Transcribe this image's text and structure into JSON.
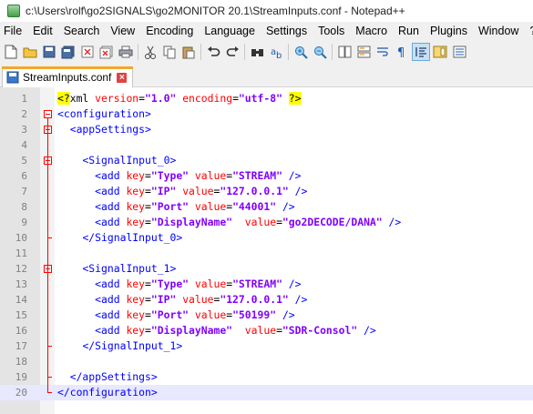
{
  "window": {
    "title": "c:\\Users\\rolf\\go2SIGNALS\\go2MONITOR 20.1\\StreamInputs.conf - Notepad++"
  },
  "menu": {
    "items": [
      "File",
      "Edit",
      "Search",
      "View",
      "Encoding",
      "Language",
      "Settings",
      "Tools",
      "Macro",
      "Run",
      "Plugins",
      "Window",
      "?"
    ]
  },
  "toolbar": {
    "buttons": [
      "new-file",
      "open-file",
      "save",
      "save-all",
      "close",
      "close-all",
      "print",
      "cut",
      "copy",
      "paste",
      "undo",
      "redo",
      "find",
      "replace",
      "zoom-in",
      "zoom-out",
      "sync-vertical",
      "sync-horizontal",
      "word-wrap",
      "show-all-characters",
      "indent-guide",
      "document-map",
      "function-list"
    ]
  },
  "tabs": [
    {
      "label": "StreamInputs.conf",
      "active": true
    }
  ],
  "editor": {
    "current_line": 20,
    "lines": [
      {
        "n": "1",
        "text": "<?xml version=\"1.0\" encoding=\"utf-8\" ?>"
      },
      {
        "n": "2",
        "text": "<configuration>"
      },
      {
        "n": "3",
        "text": "  <appSettings>"
      },
      {
        "n": "4",
        "text": ""
      },
      {
        "n": "5",
        "text": "    <SignalInput_0>"
      },
      {
        "n": "6",
        "text": "      <add key=\"Type\" value=\"STREAM\" />"
      },
      {
        "n": "7",
        "text": "      <add key=\"IP\" value=\"127.0.0.1\" />"
      },
      {
        "n": "8",
        "text": "      <add key=\"Port\" value=\"44001\" />"
      },
      {
        "n": "9",
        "text": "      <add key=\"DisplayName\"  value=\"go2DECODE/DANA\" />"
      },
      {
        "n": "10",
        "text": "    </SignalInput_0>"
      },
      {
        "n": "11",
        "text": ""
      },
      {
        "n": "12",
        "text": "    <SignalInput_1>"
      },
      {
        "n": "13",
        "text": "      <add key=\"Type\" value=\"STREAM\" />"
      },
      {
        "n": "14",
        "text": "      <add key=\"IP\" value=\"127.0.0.1\" />"
      },
      {
        "n": "15",
        "text": "      <add key=\"Port\" value=\"50199\" />"
      },
      {
        "n": "16",
        "text": "      <add key=\"DisplayName\"  value=\"SDR-Consol\" />"
      },
      {
        "n": "17",
        "text": "    </SignalInput_1>"
      },
      {
        "n": "18",
        "text": ""
      },
      {
        "n": "19",
        "text": "  </appSettings>"
      },
      {
        "n": "20",
        "text": "</configuration>"
      }
    ]
  },
  "colors": {
    "tag": "#0000ff",
    "attribute": "#ff0000",
    "value": "#8000ff",
    "pi_highlight": "#ffff00",
    "current_line": "#e8e8ff",
    "fold_marker": "#ff0000",
    "tab_accent": "#f4a72a"
  }
}
